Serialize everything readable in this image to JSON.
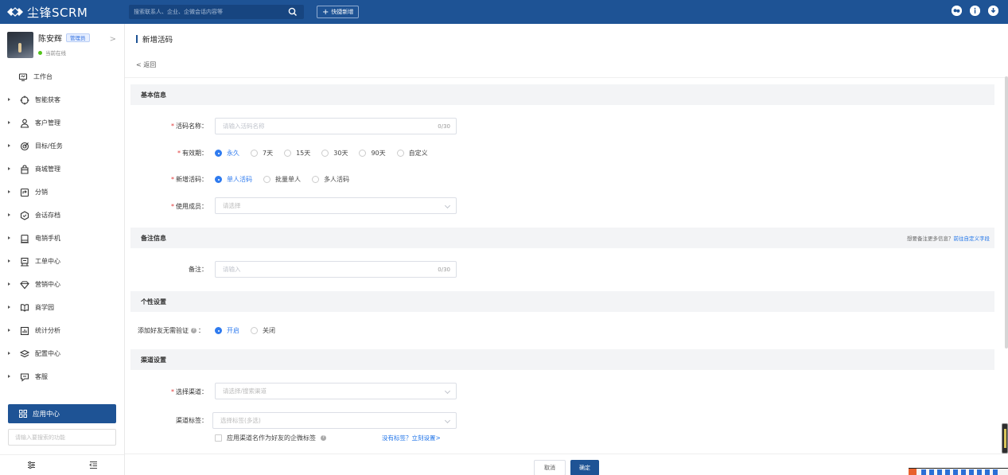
{
  "topbar": {
    "brand": "尘锋SCRM",
    "search_placeholder": "搜索联系人、企业、企微会话内容等",
    "quick_add": "快捷新增",
    "colors": {
      "bar": "#1e5395",
      "accent": "#2f7bef"
    },
    "icons": [
      "message-icon",
      "info-icon",
      "download-icon"
    ]
  },
  "user": {
    "name": "陈安辉",
    "role_badge": "管理员",
    "status": "当前在线"
  },
  "sidebar": {
    "items": [
      {
        "label": "工作台",
        "icon": "monitor-icon",
        "expandable": false
      },
      {
        "label": "智能获客",
        "icon": "target-icon",
        "expandable": true
      },
      {
        "label": "客户管理",
        "icon": "users-icon",
        "expandable": true
      },
      {
        "label": "目标/任务",
        "icon": "goal-icon",
        "expandable": true
      },
      {
        "label": "商城管理",
        "icon": "bag-icon",
        "expandable": true
      },
      {
        "label": "分销",
        "icon": "share-icon",
        "expandable": true
      },
      {
        "label": "会话存档",
        "icon": "archive-icon",
        "expandable": true
      },
      {
        "label": "电销手机",
        "icon": "phone-icon",
        "expandable": true
      },
      {
        "label": "工单中心",
        "icon": "ticket-icon",
        "expandable": true
      },
      {
        "label": "营销中心",
        "icon": "diamond-icon",
        "expandable": true
      },
      {
        "label": "商学园",
        "icon": "book-icon",
        "expandable": true
      },
      {
        "label": "统计分析",
        "icon": "chart-icon",
        "expandable": true
      },
      {
        "label": "配置中心",
        "icon": "layers-icon",
        "expandable": true
      },
      {
        "label": "客服",
        "icon": "chat-icon",
        "expandable": true
      }
    ],
    "app_center": "应用中心",
    "func_search_placeholder": "请输入要搜索的功能"
  },
  "page": {
    "title": "新增活码",
    "back": "返回"
  },
  "sections": {
    "basic": "基本信息",
    "remark": "备注信息",
    "remark_hint": "想要备注更多信息？",
    "remark_link": "前往自定义字段",
    "personal": "个性设置",
    "channel": "渠道设置"
  },
  "form": {
    "name_label": "活码名称：",
    "name_placeholder": "请输入活码名称",
    "name_count": "0/30",
    "validity_label": "有效期：",
    "validity_options": [
      "永久",
      "7天",
      "15天",
      "30天",
      "90天",
      "自定义"
    ],
    "validity_selected": "永久",
    "type_label": "新增活码：",
    "type_options": [
      "单人活码",
      "批量单人",
      "多人活码"
    ],
    "type_selected": "单人活码",
    "member_label": "使用成员：",
    "member_placeholder": "请选择",
    "remark_label": "备注：",
    "remark_placeholder": "请输入",
    "remark_count": "0/30",
    "verify_label": "添加好友无需验证",
    "verify_colon": "：",
    "verify_options": [
      "开启",
      "关闭"
    ],
    "verify_selected": "开启",
    "channel_label": "选择渠道：",
    "channel_placeholder": "请选择/搜索渠道",
    "tag_label": "渠道标签：",
    "tag_placeholder": "选择标签(多选)",
    "tag_checkbox": "应用渠道名作为好友的企微标签",
    "tag_link": "没有标签？立刻设置>"
  },
  "footer": {
    "cancel": "取消",
    "confirm": "确定"
  }
}
